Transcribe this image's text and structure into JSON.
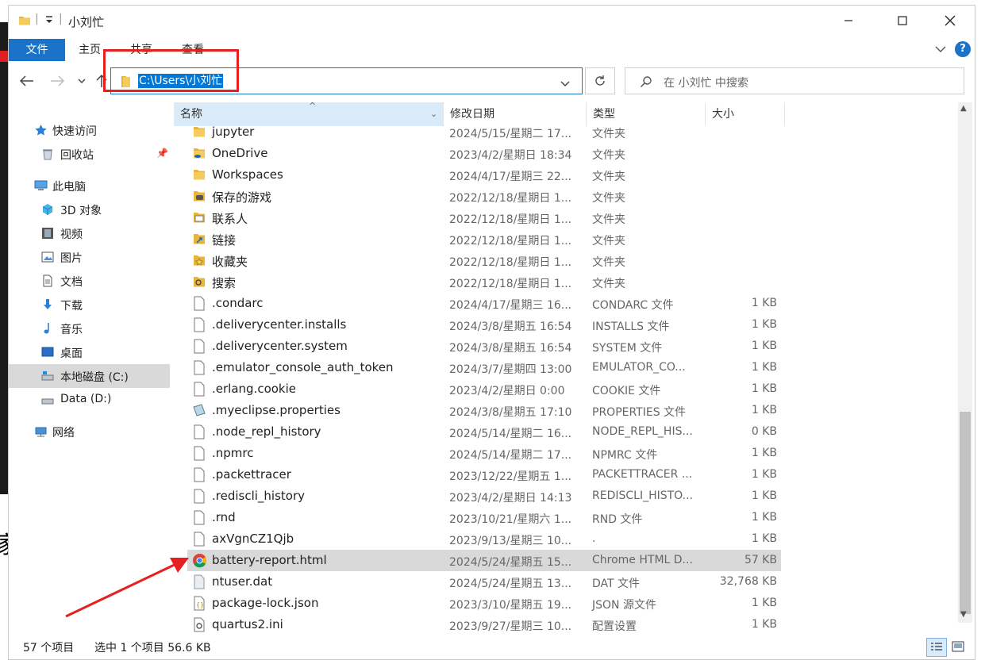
{
  "window": {
    "title": "小刘忙",
    "controls": {
      "minimize": "—",
      "maximize": "☐",
      "close": "✕"
    }
  },
  "ribbon": {
    "tabs": [
      "文件",
      "主页",
      "共享",
      "查看"
    ],
    "help": "?"
  },
  "nav": {
    "address": "C:\\Users\\小刘忙",
    "search_placeholder": "在 小刘忙 中搜索"
  },
  "sidebar": {
    "items": [
      {
        "label": "快速访问",
        "icon": "star-icon"
      },
      {
        "label": "回收站",
        "icon": "recycle-bin-icon"
      },
      {
        "label": "此电脑",
        "icon": "computer-icon"
      },
      {
        "label": "3D 对象",
        "icon": "3d-objects-icon"
      },
      {
        "label": "视频",
        "icon": "video-icon"
      },
      {
        "label": "图片",
        "icon": "pictures-icon"
      },
      {
        "label": "文档",
        "icon": "documents-icon"
      },
      {
        "label": "下载",
        "icon": "download-icon"
      },
      {
        "label": "音乐",
        "icon": "music-icon"
      },
      {
        "label": "桌面",
        "icon": "desktop-icon"
      },
      {
        "label": "本地磁盘 (C:)",
        "icon": "drive-c-icon",
        "selected": true
      },
      {
        "label": "Data (D:)",
        "icon": "drive-d-icon"
      },
      {
        "label": "网络",
        "icon": "network-icon"
      }
    ]
  },
  "columns": {
    "name": "名称",
    "date": "修改日期",
    "type": "类型",
    "size": "大小"
  },
  "files": [
    {
      "name": "jupyter",
      "date": "2024/5/15/星期二 17...",
      "type": "文件夹",
      "size": "",
      "icon": "folder"
    },
    {
      "name": "OneDrive",
      "date": "2023/4/2/星期日 18:34",
      "type": "文件夹",
      "size": "",
      "icon": "onedrive"
    },
    {
      "name": "Workspaces",
      "date": "2024/4/17/星期三 22...",
      "type": "文件夹",
      "size": "",
      "icon": "folder"
    },
    {
      "name": "保存的游戏",
      "date": "2022/12/18/星期日 1...",
      "type": "文件夹",
      "size": "",
      "icon": "games"
    },
    {
      "name": "联系人",
      "date": "2022/12/18/星期日 1...",
      "type": "文件夹",
      "size": "",
      "icon": "contacts"
    },
    {
      "name": "链接",
      "date": "2022/12/18/星期日 1...",
      "type": "文件夹",
      "size": "",
      "icon": "links"
    },
    {
      "name": "收藏夹",
      "date": "2022/12/18/星期日 1...",
      "type": "文件夹",
      "size": "",
      "icon": "favorites"
    },
    {
      "name": "搜索",
      "date": "2022/12/18/星期日 1...",
      "type": "文件夹",
      "size": "",
      "icon": "searches"
    },
    {
      "name": ".condarc",
      "date": "2024/4/17/星期三 16...",
      "type": "CONDARC 文件",
      "size": "1 KB",
      "icon": "file"
    },
    {
      "name": ".deliverycenter.installs",
      "date": "2024/3/8/星期五 16:54",
      "type": "INSTALLS 文件",
      "size": "1 KB",
      "icon": "file"
    },
    {
      "name": ".deliverycenter.system",
      "date": "2024/3/8/星期五 16:54",
      "type": "SYSTEM 文件",
      "size": "1 KB",
      "icon": "file"
    },
    {
      "name": ".emulator_console_auth_token",
      "date": "2024/3/7/星期四 13:00",
      "type": "EMULATOR_CO...",
      "size": "1 KB",
      "icon": "file"
    },
    {
      "name": ".erlang.cookie",
      "date": "2023/4/2/星期日 0:00",
      "type": "COOKIE 文件",
      "size": "1 KB",
      "icon": "file"
    },
    {
      "name": ".myeclipse.properties",
      "date": "2024/3/8/星期五 17:10",
      "type": "PROPERTIES 文件",
      "size": "1 KB",
      "icon": "properties"
    },
    {
      "name": ".node_repl_history",
      "date": "2024/5/14/星期二 16...",
      "type": "NODE_REPL_HIS...",
      "size": "0 KB",
      "icon": "file"
    },
    {
      "name": ".npmrc",
      "date": "2024/5/14/星期二 17...",
      "type": "NPMRC 文件",
      "size": "1 KB",
      "icon": "file"
    },
    {
      "name": ".packettracer",
      "date": "2023/12/22/星期五 1...",
      "type": "PACKETTRACER ...",
      "size": "1 KB",
      "icon": "file"
    },
    {
      "name": ".rediscli_history",
      "date": "2023/4/2/星期日 14:13",
      "type": "REDISCLI_HISTO...",
      "size": "1 KB",
      "icon": "file"
    },
    {
      "name": ".rnd",
      "date": "2023/10/21/星期六 1...",
      "type": "RND 文件",
      "size": "1 KB",
      "icon": "file"
    },
    {
      "name": "axVgnCZ1Qjb",
      "date": "2023/9/13/星期三 10...",
      "type": ".",
      "size": "1 KB",
      "icon": "file"
    },
    {
      "name": "battery-report.html",
      "date": "2024/5/24/星期五 15...",
      "type": "Chrome HTML D...",
      "size": "57 KB",
      "icon": "chrome",
      "selected": true
    },
    {
      "name": "ntuser.dat",
      "date": "2024/5/24/星期五 13...",
      "type": "DAT 文件",
      "size": "32,768 KB",
      "icon": "dat"
    },
    {
      "name": "package-lock.json",
      "date": "2023/3/10/星期五 19...",
      "type": "JSON 源文件",
      "size": "1 KB",
      "icon": "json"
    },
    {
      "name": "quartus2.ini",
      "date": "2023/9/27/星期三 10...",
      "type": "配置设置",
      "size": "1 KB",
      "icon": "ini"
    }
  ],
  "status": {
    "count": "57 个项目",
    "selection": "选中 1 个项目  56.6 KB"
  }
}
